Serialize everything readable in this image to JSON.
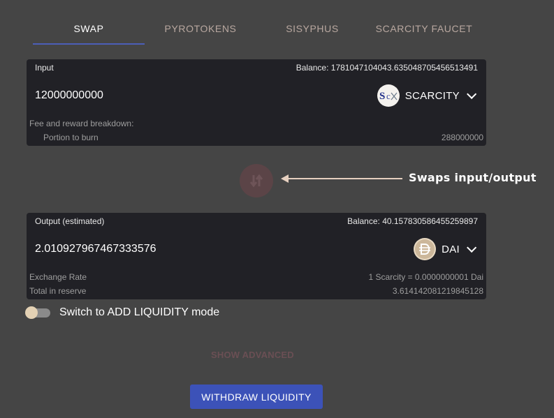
{
  "tabs": [
    {
      "label": "SWAP",
      "active": true
    },
    {
      "label": "PYROTOKENS",
      "active": false
    },
    {
      "label": "SISYPHUS",
      "active": false
    },
    {
      "label": "SCARCITY FAUCET",
      "active": false
    }
  ],
  "input_panel": {
    "label": "Input",
    "balance": "Balance: 1781047104043.635048705456513491",
    "amount": "12000000000",
    "token": {
      "name": "SCARCITY",
      "icon": "scarcity-logo-icon"
    },
    "fee_title": "Fee and reward breakdown:",
    "fee_rows": [
      {
        "label": "Portion to burn",
        "value": "288000000"
      }
    ]
  },
  "swap_button": {
    "icon": "swap-direction-icon"
  },
  "annotation": {
    "text": "Swaps input/output"
  },
  "output_panel": {
    "label": "Output (estimated)",
    "balance": "Balance: 40.157830586455259897",
    "amount": "2.010927967467333576",
    "token": {
      "name": "DAI",
      "icon": "dai-logo-icon"
    },
    "rows": [
      {
        "label": "Exchange Rate",
        "value": "1 Scarcity = 0.0000000001 Dai"
      },
      {
        "label": "Total in reserve",
        "value": "3.614142081219845128"
      }
    ]
  },
  "liquidity_toggle": {
    "label": "Switch to ADD LIQUIDITY mode",
    "checked": false
  },
  "show_advanced": {
    "label": "SHOW ADVANCED"
  },
  "withdraw_button": {
    "label": "WITHDRAW LIQUIDITY"
  },
  "colors": {
    "accent": "#3c52b8",
    "panel": "#212126",
    "background": "#454545",
    "annotation_arrow": "#e6d0c0"
  }
}
